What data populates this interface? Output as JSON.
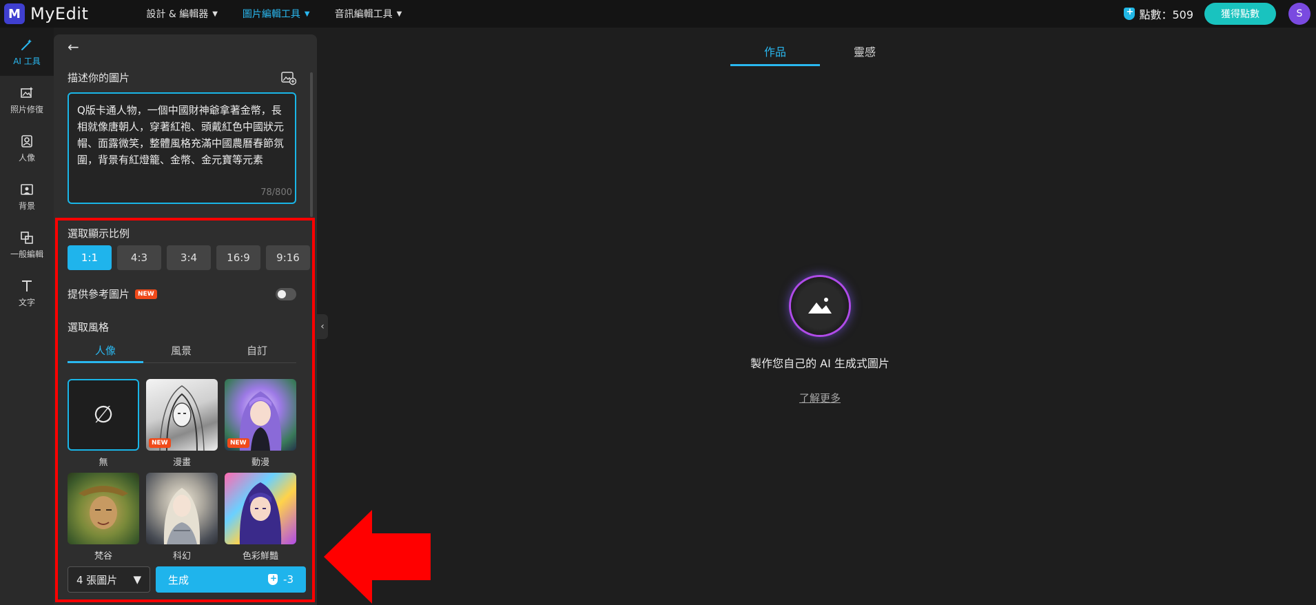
{
  "header": {
    "logo_letter": "M",
    "app_name": "MyEdit",
    "nav": [
      {
        "label": "設計 & 編輯器"
      },
      {
        "label": "圖片編輯工具"
      },
      {
        "label": "音訊編輯工具"
      }
    ],
    "points_label": "點數：509",
    "get_points_label": "獲得點數",
    "avatar_initial": "S"
  },
  "rail": [
    {
      "label": "AI 工具",
      "icon": "magic-wand-icon"
    },
    {
      "label": "照片修復",
      "icon": "photo-restore-icon"
    },
    {
      "label": "人像",
      "icon": "portrait-icon"
    },
    {
      "label": "背景",
      "icon": "background-icon"
    },
    {
      "label": "一般編輯",
      "icon": "crop-icon"
    },
    {
      "label": "文字",
      "icon": "text-icon"
    }
  ],
  "panel": {
    "describe_label": "描述你的圖片",
    "prompt_text": "Q版卡通人物，一個中國財神爺拿著金幣，長相就像唐朝人，穿著紅袍、頭戴紅色中國狀元帽、面露微笑，整體風格充滿中國農曆春節氛圍，背景有紅燈籠、金幣、金元寶等元素",
    "char_count": "78/800",
    "ratio_label": "選取顯示比例",
    "ratios": [
      "1:1",
      "4:3",
      "3:4",
      "16:9",
      "9:16"
    ],
    "ratio_selected": "1:1",
    "reference_label": "提供參考圖片",
    "new_badge": "NEW",
    "reference_enabled": false,
    "style_label": "選取風格",
    "style_tabs": [
      "人像",
      "風景",
      "自訂"
    ],
    "style_tab_selected": "人像",
    "styles": [
      {
        "name": "無",
        "badge": ""
      },
      {
        "name": "漫畫",
        "badge": "NEW"
      },
      {
        "name": "動漫",
        "badge": "NEW"
      },
      {
        "name": "梵谷",
        "badge": ""
      },
      {
        "name": "科幻",
        "badge": ""
      },
      {
        "name": "色彩鮮豔",
        "badge": ""
      }
    ],
    "none_symbol": "∅",
    "image_count": "4 張圖片",
    "generate_label": "生成",
    "generate_cost": "-3"
  },
  "main": {
    "tabs": [
      "作品",
      "靈感"
    ],
    "tab_selected": "作品",
    "empty_text": "製作您自己的 AI 生成式圖片",
    "learn_more": "了解更多"
  },
  "colors": {
    "accent": "#1fb4ec",
    "annotation": "#ff0000"
  }
}
